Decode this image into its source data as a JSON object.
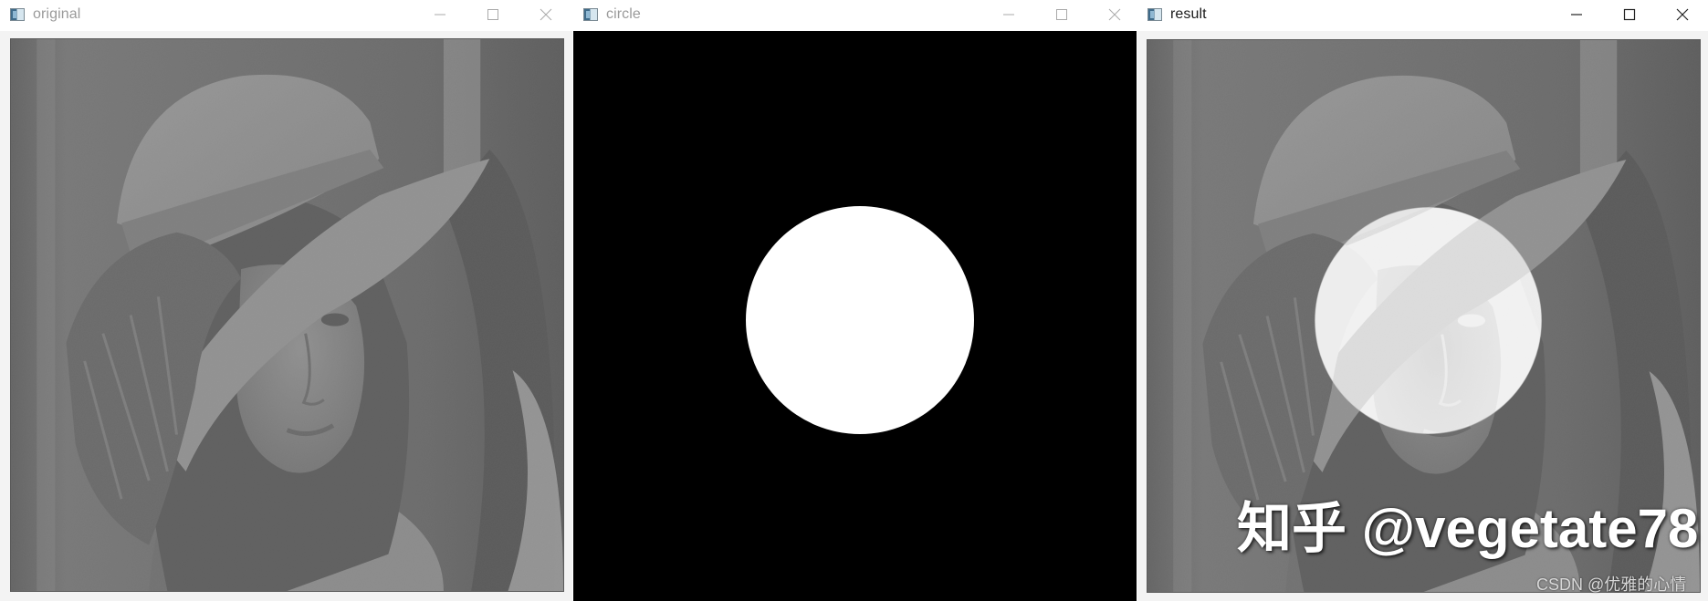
{
  "windows": [
    {
      "title": "original",
      "active": false
    },
    {
      "title": "circle",
      "active": false
    },
    {
      "title": "result",
      "active": true
    }
  ],
  "watermark": "知乎 @vegetate78",
  "footnote": "CSDN @优雅的心情",
  "colors": {
    "titlebar": "#ffffff",
    "inactive_title": "#9a9a9a",
    "active_title": "#1a1a1a",
    "mask_background": "#000000",
    "mask_circle": "#ffffff",
    "window_background": "#f3f3f3"
  },
  "icons": [
    "app-icon",
    "minimize-icon",
    "maximize-icon",
    "close-icon"
  ]
}
